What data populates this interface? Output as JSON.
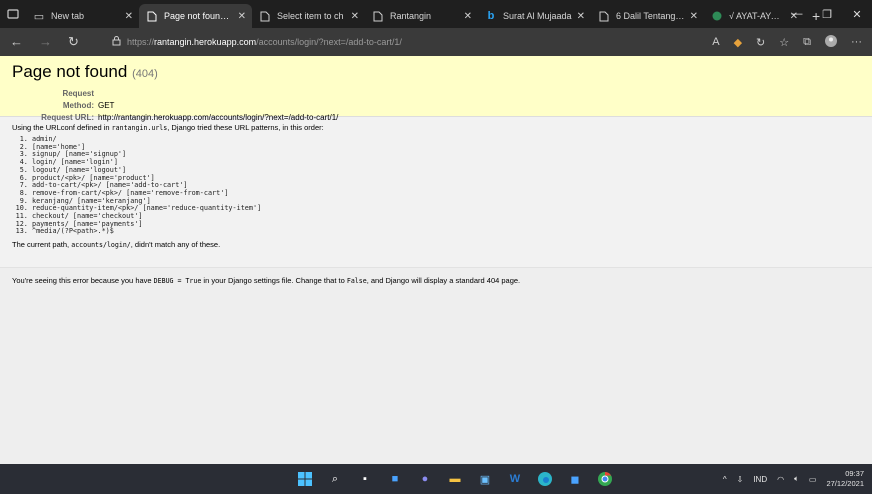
{
  "tabs": [
    {
      "title": "New tab",
      "active": false
    },
    {
      "title": "Page not found at",
      "active": true
    },
    {
      "title": "Select item to ch",
      "active": false
    },
    {
      "title": "Rantangin",
      "active": false
    },
    {
      "title": "Surat Al Mujaada",
      "active": false
    },
    {
      "title": "6 Dalil Tentang Pe",
      "active": false
    },
    {
      "title": "√ AYAT-AYAT AL-",
      "active": false
    }
  ],
  "address": {
    "scheme": "https://",
    "host": "rantangin.herokuapp.com",
    "path": "/accounts/login/?next=/add-to-cart/1/"
  },
  "error": {
    "title": "Page not found",
    "code": "(404)",
    "request_method_label": "Request Method:",
    "request_method": "GET",
    "request_url_label": "Request URL:",
    "request_url": "http://rantangin.herokuapp.com/accounts/login/?next=/add-to-cart/1/"
  },
  "info": {
    "intro_prefix": "Using the URLconf defined in",
    "urlconf": "rantangin.urls",
    "intro_suffix": ", Django tried these URL patterns, in this order:",
    "patterns": [
      "admin/",
      "[name='home']",
      "signup/ [name='signup']",
      "login/ [name='login']",
      "logout/ [name='logout']",
      "product/<pk>/ [name='product']",
      "add-to-cart/<pk>/ [name='add-to-cart']",
      "remove-from-cart/<pk>/ [name='remove-from-cart']",
      "keranjang/ [name='keranjang']",
      "reduce-quantity-item/<pk>/ [name='reduce-quantity-item']",
      "checkout/ [name='checkout']",
      "payments/ [name='payments']",
      "^media/(?P<path>.*)$"
    ],
    "current_prefix": "The current path,",
    "current_path": "accounts/login/",
    "current_suffix": ", didn't match any of these."
  },
  "explanation": {
    "prefix": "You're seeing this error because you have",
    "debug": "DEBUG = True",
    "middle": "in your Django settings file. Change that to",
    "false_val": "False",
    "suffix": ", and Django will display a standard 404 page."
  },
  "tray": {
    "lang": "IND",
    "time": "09:37",
    "date": "27/12/2021"
  },
  "colors": {
    "summary_bg": "#ffffc8",
    "page_bg": "#f2f2f2",
    "taskbar_bg": "#2a2d35"
  }
}
